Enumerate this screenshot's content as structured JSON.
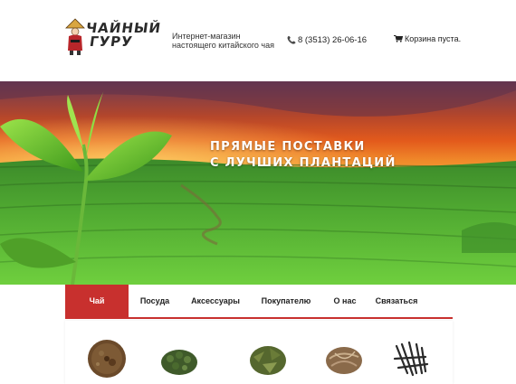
{
  "header": {
    "logo_line1": "ЧАЙНЫЙ",
    "logo_line2": "ГУРУ",
    "tagline_line1": "Интернет-магазин",
    "tagline_line2": "настоящего китайского чая",
    "phone": "8 (3513) 26-06-16",
    "cart_text": "Корзина пуста."
  },
  "hero": {
    "line1": "ПРЯМЫЕ ПОСТАВКИ",
    "line2": "С ЛУЧШИХ ПЛАНТАЦИЙ"
  },
  "nav": {
    "items": [
      {
        "label": "Чай",
        "active": true
      },
      {
        "label": "Посуда",
        "active": false
      },
      {
        "label": "Аксессуары",
        "active": false
      },
      {
        "label": "Покупателю",
        "active": false
      },
      {
        "label": "О нас",
        "active": false
      },
      {
        "label": "Связаться",
        "active": false
      }
    ]
  },
  "colors": {
    "accent": "#c8302e"
  },
  "products": [
    {
      "icon": "pressed-pu-erh-tea-image"
    },
    {
      "icon": "green-oolong-tea-image"
    },
    {
      "icon": "green-tea-leaves-image"
    },
    {
      "icon": "white-tea-leaves-image"
    },
    {
      "icon": "black-needle-tea-image"
    }
  ]
}
